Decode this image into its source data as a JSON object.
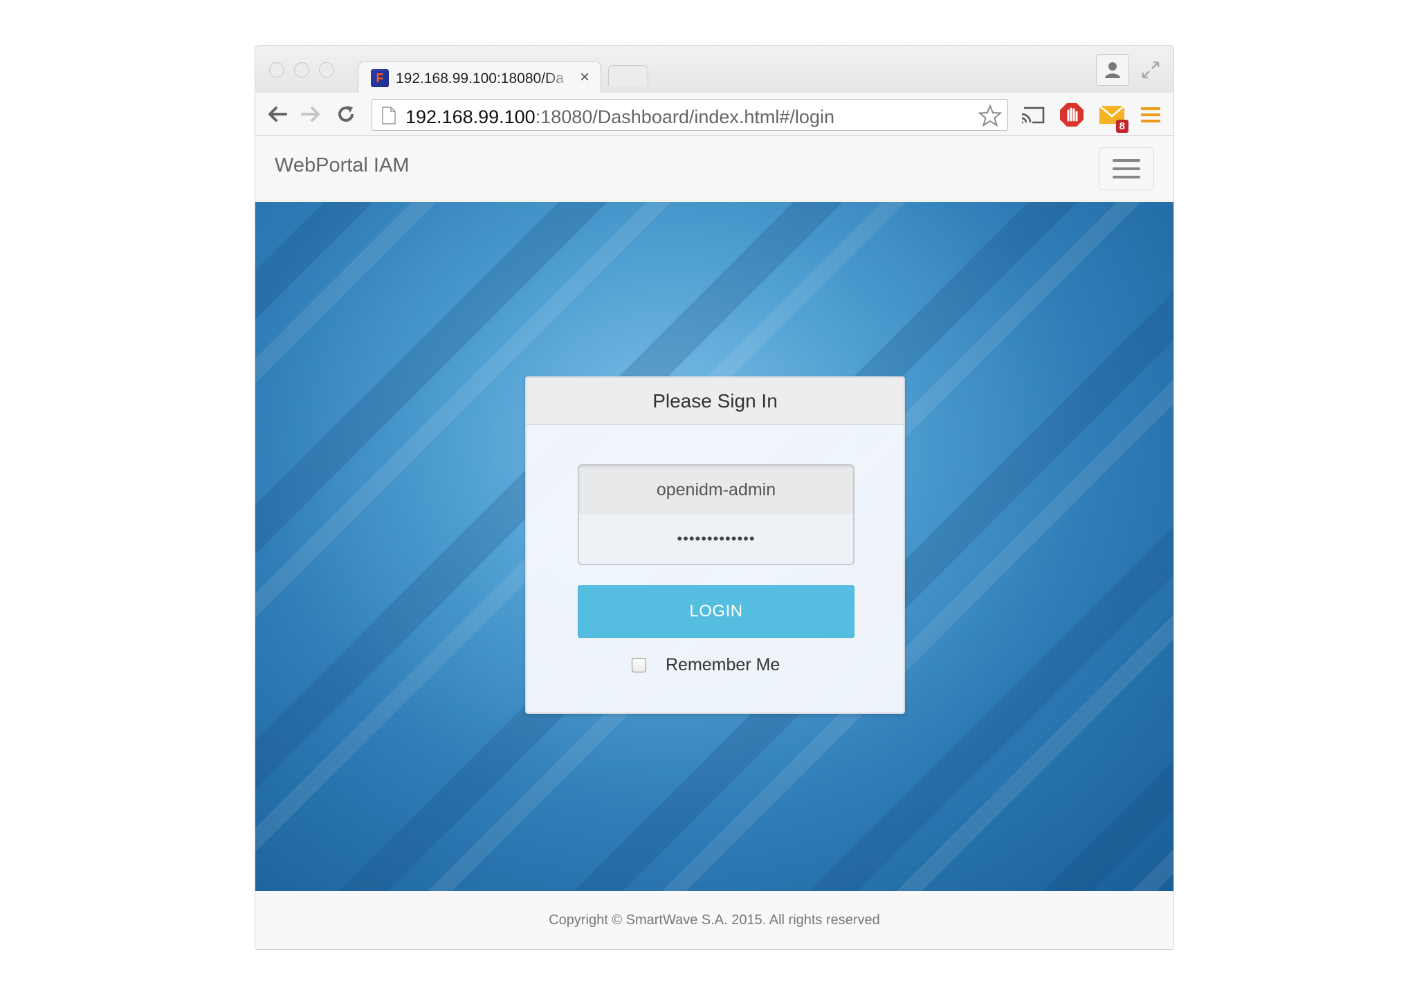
{
  "browser": {
    "tab_title": "192.168.99.100:18080/Da",
    "tab_close": "×",
    "url_host": "192.168.99.100",
    "url_rest": ":18080/Dashboard/index.html#/login",
    "ext_badge": "8"
  },
  "navbar": {
    "brand": "WebPortal IAM"
  },
  "login": {
    "title": "Please Sign In",
    "username_value": "openidm-admin",
    "password_masked": "•••••••••••••",
    "login_label": "LOGIN",
    "remember_label": "Remember Me",
    "remember_checked": false
  },
  "footer": {
    "copyright": "Copyright © SmartWave S.A. 2015. All rights reserved"
  },
  "colors": {
    "login_button": "#55bde0",
    "hero_blue": "#2f7cb6"
  }
}
